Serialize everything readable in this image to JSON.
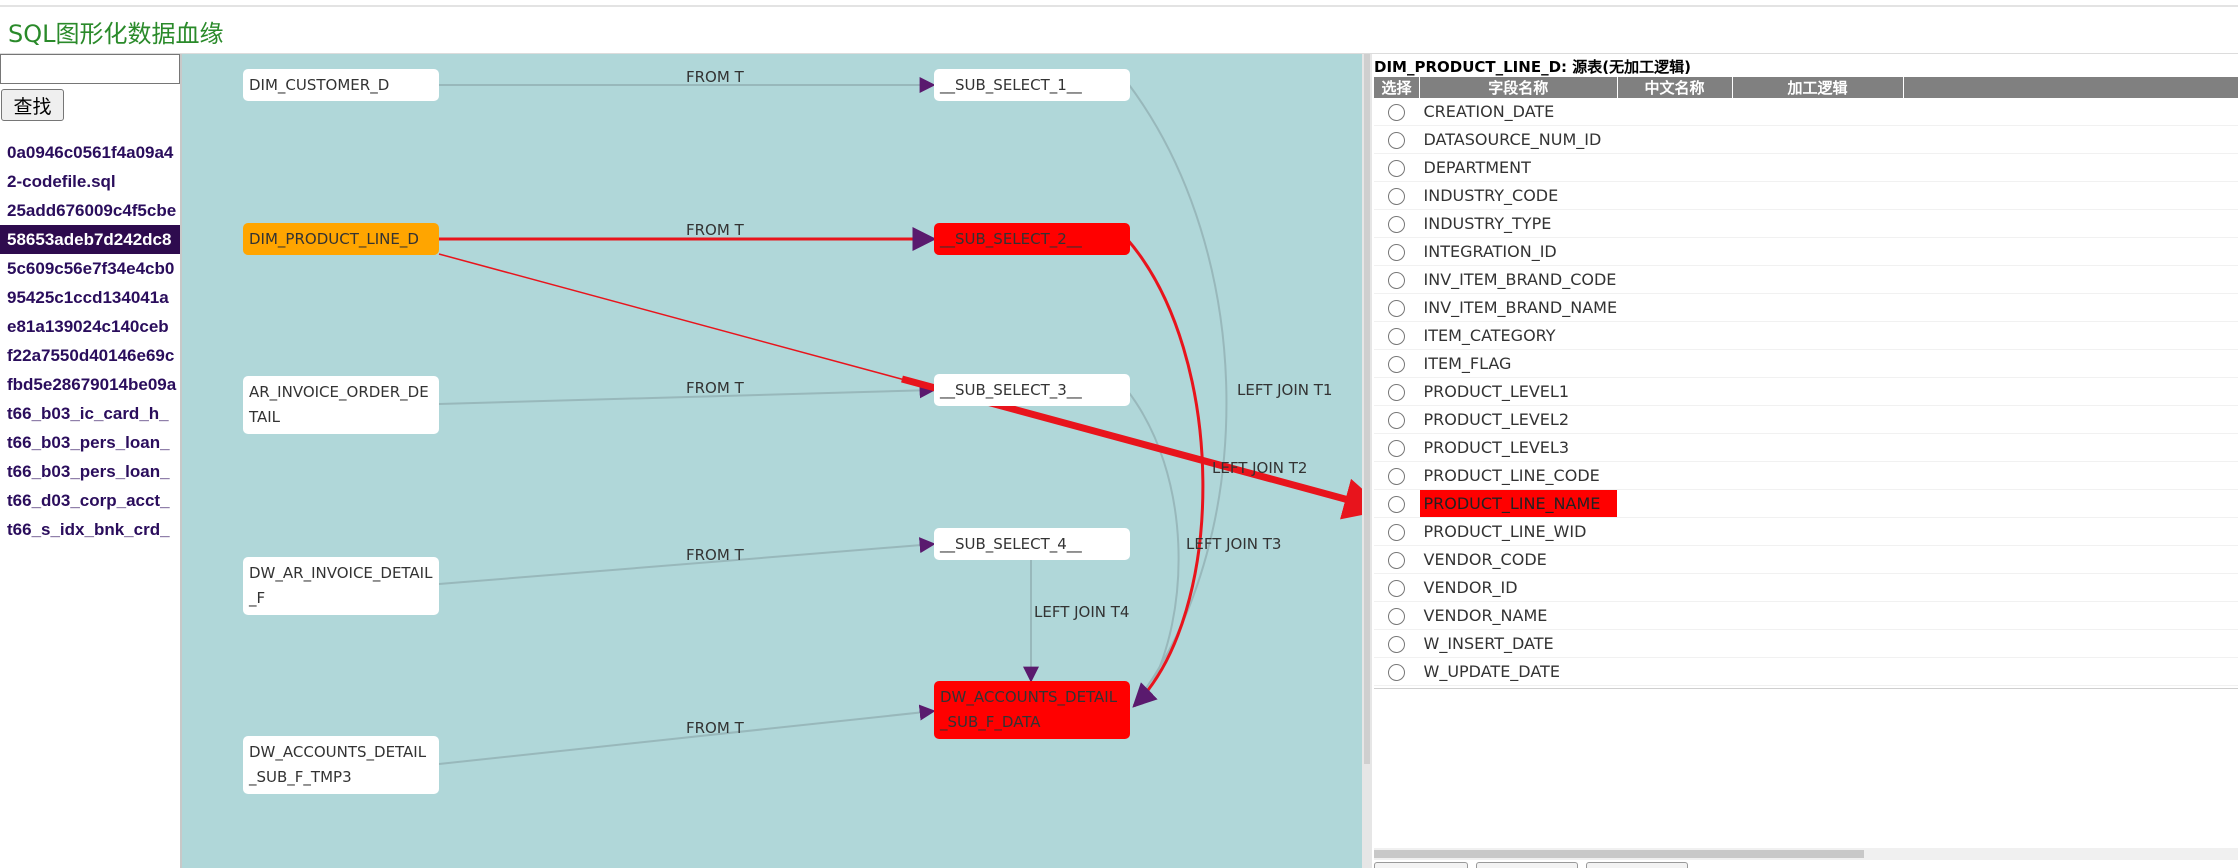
{
  "app": {
    "title": "SQL图形化数据血缘"
  },
  "search": {
    "placeholder": "",
    "value": "",
    "button_label": "查找"
  },
  "files": [
    {
      "label": "0a0946c0561f4a09a4",
      "selected": false
    },
    {
      "label": "2-codefile.sql",
      "selected": false
    },
    {
      "label": "25add676009c4f5cbe",
      "selected": false
    },
    {
      "label": "58653adeb7d242dc8",
      "selected": true
    },
    {
      "label": "5c609c56e7f34e4cb0",
      "selected": false
    },
    {
      "label": "95425c1ccd134041a",
      "selected": false
    },
    {
      "label": "e81a139024c140ceb",
      "selected": false
    },
    {
      "label": "f22a7550d40146e69c",
      "selected": false
    },
    {
      "label": "fbd5e28679014be09a",
      "selected": false
    },
    {
      "label": "t66_b03_ic_card_h_",
      "selected": false
    },
    {
      "label": "t66_b03_pers_loan_",
      "selected": false
    },
    {
      "label": "t66_b03_pers_loan_",
      "selected": false
    },
    {
      "label": "t66_d03_corp_acct_",
      "selected": false
    },
    {
      "label": "t66_s_idx_bnk_crd_",
      "selected": false
    }
  ],
  "graph": {
    "nodes": {
      "dim_customer_d": "DIM_CUSTOMER_D",
      "dim_product_line_d": "DIM_PRODUCT_LINE_D",
      "ar_invoice_order_detail": "AR_INVOICE_ORDER_DETAIL",
      "dw_ar_invoice_detail_f": "DW_AR_INVOICE_DETAIL_F",
      "dw_accounts_detail_sub_f_tmp3": "DW_ACCOUNTS_DETAIL_SUB_F_TMP3",
      "sub_select_1": "__SUB_SELECT_1__",
      "sub_select_2": "__SUB_SELECT_2__",
      "sub_select_3": "__SUB_SELECT_3__",
      "sub_select_4": "__SUB_SELECT_4__",
      "dw_accounts_detail_sub_f_data": "DW_ACCOUNTS_DETAIL_SUB_F_DATA"
    },
    "edge_labels": {
      "from1": "FROM T",
      "from2": "FROM T",
      "from3": "FROM T",
      "from4": "FROM T",
      "from5": "FROM T",
      "lj1": "LEFT JOIN T1",
      "lj2": "LEFT JOIN T2",
      "lj3": "LEFT JOIN T3",
      "lj4": "LEFT JOIN T4"
    },
    "colors": {
      "background": "#b0d7d9",
      "highlight_node": "#ff0000",
      "source_node": "#ffa500",
      "highlight_edge": "#e8141c",
      "edge": "#98b8bb",
      "arrow": "#5a1a6e"
    }
  },
  "detail": {
    "title": "DIM_PRODUCT_LINE_D: 源表(无加工逻辑)",
    "columns": {
      "select": "选择",
      "field_name": "字段名称",
      "chinese_name": "中文名称",
      "logic": "加工逻辑"
    },
    "rows": [
      {
        "field": "CREATION_DATE",
        "highlight": false
      },
      {
        "field": "DATASOURCE_NUM_ID",
        "highlight": false
      },
      {
        "field": "DEPARTMENT",
        "highlight": false
      },
      {
        "field": "INDUSTRY_CODE",
        "highlight": false
      },
      {
        "field": "INDUSTRY_TYPE",
        "highlight": false
      },
      {
        "field": "INTEGRATION_ID",
        "highlight": false
      },
      {
        "field": "INV_ITEM_BRAND_CODE",
        "highlight": false
      },
      {
        "field": "INV_ITEM_BRAND_NAME",
        "highlight": false
      },
      {
        "field": "ITEM_CATEGORY",
        "highlight": false
      },
      {
        "field": "ITEM_FLAG",
        "highlight": false
      },
      {
        "field": "PRODUCT_LEVEL1",
        "highlight": false
      },
      {
        "field": "PRODUCT_LEVEL2",
        "highlight": false
      },
      {
        "field": "PRODUCT_LEVEL3",
        "highlight": false
      },
      {
        "field": "PRODUCT_LINE_CODE",
        "highlight": false
      },
      {
        "field": "PRODUCT_LINE_NAME",
        "highlight": true
      },
      {
        "field": "PRODUCT_LINE_WID",
        "highlight": false
      },
      {
        "field": "VENDOR_CODE",
        "highlight": false
      },
      {
        "field": "VENDOR_ID",
        "highlight": false
      },
      {
        "field": "VENDOR_NAME",
        "highlight": false
      },
      {
        "field": "W_INSERT_DATE",
        "highlight": false
      },
      {
        "field": "W_UPDATE_DATE",
        "highlight": false
      }
    ]
  }
}
